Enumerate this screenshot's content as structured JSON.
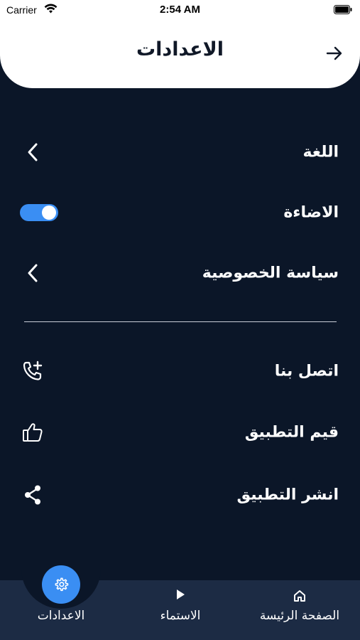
{
  "status_bar": {
    "carrier": "Carrier",
    "time": "2:54 AM"
  },
  "header": {
    "title": "الاعدادات",
    "back_icon": "arrow-right-icon"
  },
  "settings": {
    "language": {
      "label": "اللغة",
      "icon": "chevron-left-icon"
    },
    "lighting": {
      "label": "الاضاءة",
      "toggle_on": true
    },
    "privacy": {
      "label": "سياسة الخصوصية",
      "icon": "chevron-left-icon"
    },
    "contact": {
      "label": "اتصل بنا",
      "icon": "phone-add-icon"
    },
    "rate": {
      "label": "قيم التطبيق",
      "icon": "thumbs-up-icon"
    },
    "share": {
      "label": "انشر التطبيق",
      "icon": "share-icon"
    }
  },
  "bottom_nav": {
    "settings": {
      "label": "الاعدادات",
      "icon": "gear-icon",
      "active": true
    },
    "listen": {
      "label": "الاستماء",
      "icon": "play-icon"
    },
    "home": {
      "label": "الصفحة الرئيسة",
      "icon": "home-icon"
    }
  },
  "colors": {
    "background": "#0b1628",
    "accent": "#3a8ef3",
    "nav": "#1c2b44",
    "header": "#ffffff"
  }
}
